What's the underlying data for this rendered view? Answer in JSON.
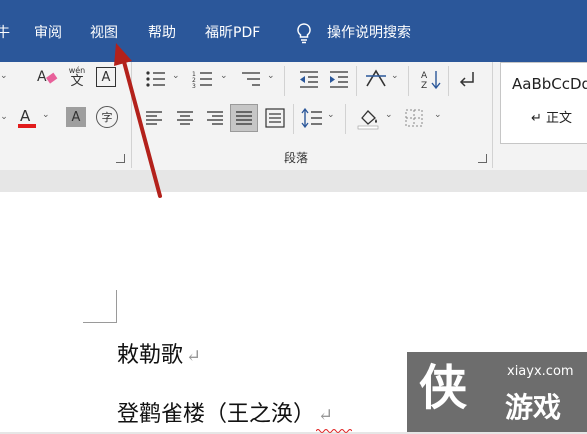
{
  "menu": {
    "partial_item": "牛",
    "items": [
      "审阅",
      "视图",
      "帮助",
      "福昕PDF"
    ],
    "search_label": "操作说明搜索"
  },
  "ribbon": {
    "paragraph_group_label": "段落",
    "style_preview": "AaBbCcDd",
    "style_name": "↵ 正文",
    "phonetic_top": "wén",
    "phonetic_bottom": "文",
    "char_border": "A",
    "enclose_char": "字"
  },
  "document": {
    "line1": "敕勒歌",
    "line2": "登鹳雀楼（王之涣）",
    "paragraph_mark": "↵"
  },
  "watermark": {
    "logo_char": "侠",
    "site": "xiayx.com",
    "name": "游戏"
  },
  "colors": {
    "menubar": "#2b579a",
    "annotation_arrow": "#b3211b",
    "font_color_bar": "#e11b1b"
  }
}
